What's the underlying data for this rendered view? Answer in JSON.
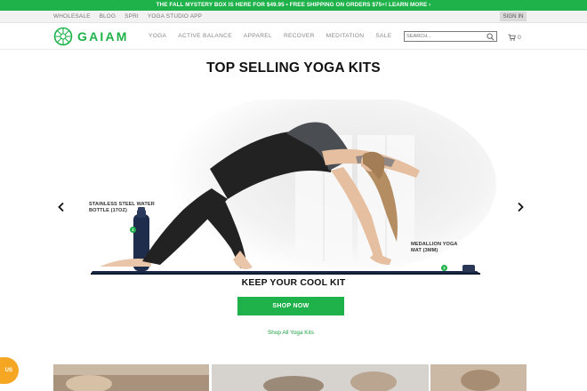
{
  "promo_bar": {
    "text": "THE FALL MYSTERY BOX IS HERE FOR $49.95 • FREE SHIPPING ON ORDERS $75+! LEARN MORE ›"
  },
  "utility_bar": {
    "links": [
      "WHOLESALE",
      "BLOG",
      "SPRI",
      "YOGA STUDIO APP"
    ],
    "sign_in": "SIGN IN"
  },
  "header": {
    "logo_text": "GAIAM",
    "nav": [
      "YOGA",
      "ACTIVE BALANCE",
      "APPAREL",
      "RECOVER",
      "MEDITATION",
      "SALE"
    ],
    "search_placeholder": "SEARCH...",
    "cart_count": "0"
  },
  "carousel": {
    "heading": "TOP SELLING YOGA KITS",
    "slide": {
      "callouts": [
        {
          "number": "1",
          "label_line1": "STAINLESS STEEL WATER",
          "label_line2": "BOTTLE (17OZ)"
        },
        {
          "number": "2",
          "label_line1": "MEDALLION YOGA",
          "label_line2": "MAT (3MM)"
        }
      ],
      "kit_title": "KEEP YOUR COOL KIT",
      "cta_label": "SHOP NOW"
    },
    "shop_all_link": "Shop All Yoga Kits"
  },
  "chat_widget": {
    "label": "US"
  },
  "colors": {
    "brand_green": "#1fb24a",
    "chat_orange": "#f5a623"
  },
  "icons": [
    "gaiam-medallion-logo",
    "search-icon",
    "cart-icon",
    "chevron-left-icon",
    "chevron-right-icon"
  ]
}
